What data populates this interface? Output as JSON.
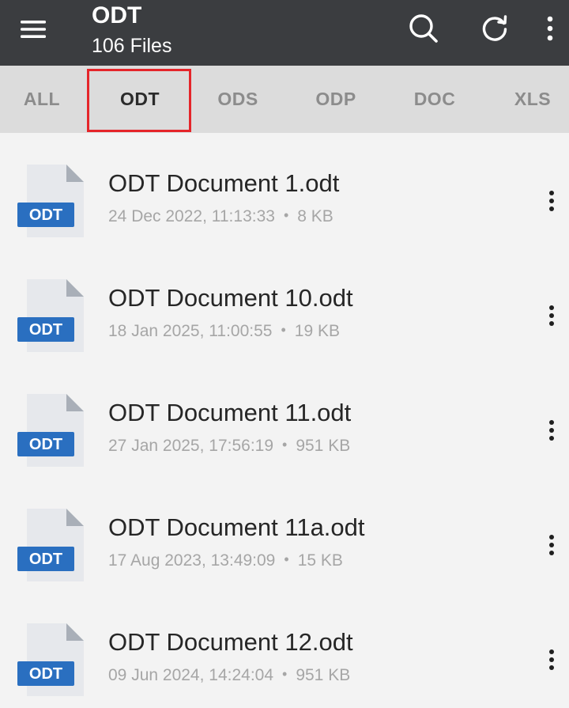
{
  "header": {
    "title": "ODT",
    "subtitle": "106 Files",
    "icons": [
      "menu-icon",
      "search-icon",
      "refresh-icon",
      "more-vertical-icon"
    ]
  },
  "tabs": [
    {
      "label": "ALL",
      "active": false
    },
    {
      "label": "ODT",
      "active": true
    },
    {
      "label": "ODS",
      "active": false
    },
    {
      "label": "ODP",
      "active": false
    },
    {
      "label": "DOC",
      "active": false
    },
    {
      "label": "XLS",
      "active": false
    }
  ],
  "files": [
    {
      "name": "ODT Document 1.odt",
      "date": "24 Dec 2022, 11:13:33",
      "size": "8 KB",
      "badge": "ODT"
    },
    {
      "name": "ODT Document 10.odt",
      "date": "18 Jan 2025, 11:00:55",
      "size": "19 KB",
      "badge": "ODT"
    },
    {
      "name": "ODT Document 11.odt",
      "date": "27 Jan 2025, 17:56:19",
      "size": "951 KB",
      "badge": "ODT"
    },
    {
      "name": "ODT Document 11a.odt",
      "date": "17 Aug 2023, 13:49:09",
      "size": "15 KB",
      "badge": "ODT"
    },
    {
      "name": "ODT Document 12.odt",
      "date": "09 Jun 2024, 14:24:04",
      "size": "951 KB",
      "badge": "ODT"
    }
  ],
  "meta_separator": "•",
  "colors": {
    "appbar": "#3b3d40",
    "tabbar": "#dcdcdc",
    "badge": "#2a6fc0",
    "highlight": "#e5252a"
  }
}
